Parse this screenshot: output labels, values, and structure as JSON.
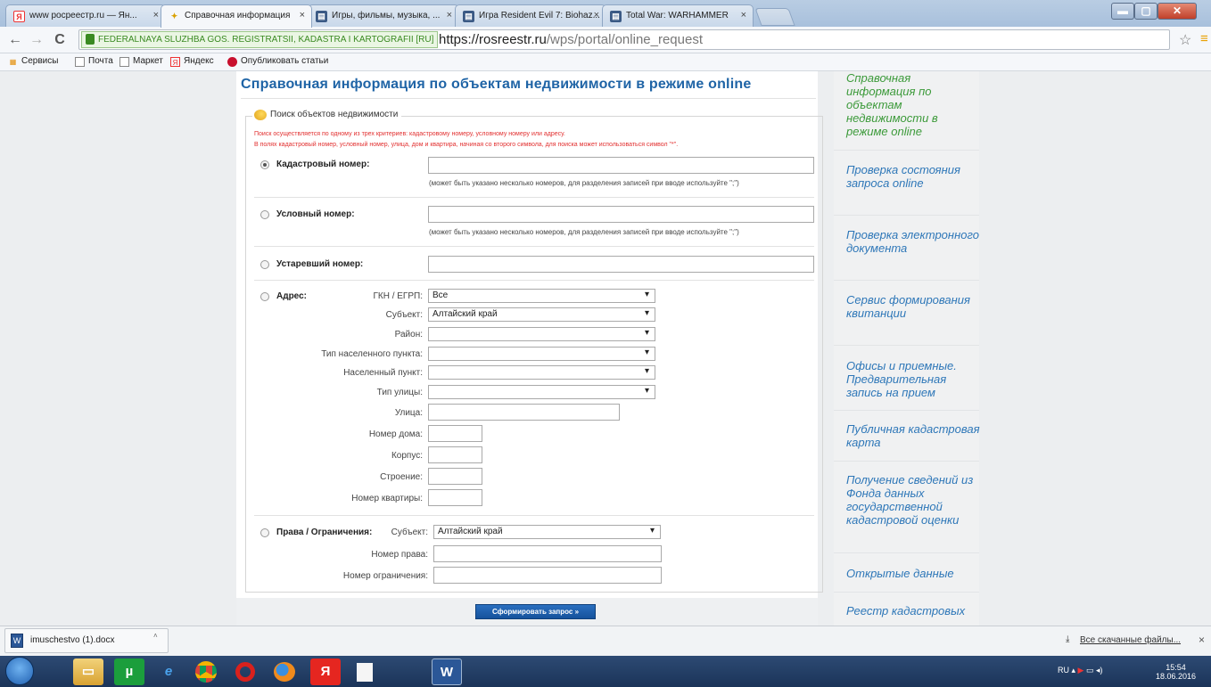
{
  "browser": {
    "tabs": [
      {
        "label": "www росреестр.ru — Ян...",
        "favicon": "Я"
      },
      {
        "label": "Справочная информация",
        "favicon": "✦"
      },
      {
        "label": "Игры, фильмы, музыка, ...",
        "favicon": "▤"
      },
      {
        "label": "Игра Resident Evil 7: Biohaz...",
        "favicon": "▤"
      },
      {
        "label": "Total War: WARHAMMER",
        "favicon": "▤"
      }
    ],
    "close_glyph": "×",
    "secure_label": "FEDERALNAYA SLUZHBA GOS. REGISTRATSII, KADASTRA I KARTOGRAFII [RU]",
    "url_host": "https://rosreestr.ru",
    "url_path": "/wps/portal/online_request",
    "bookmarks": [
      {
        "label": "Сервисы",
        "icon": "apps-icon"
      },
      {
        "label": "Почта",
        "icon": "page-icon"
      },
      {
        "label": "Маркет",
        "icon": "page-icon"
      },
      {
        "label": "Яндекс",
        "icon": "yandex-icon"
      },
      {
        "label": "Опубликовать статьи",
        "icon": "red-dot-icon"
      }
    ]
  },
  "page": {
    "title": "Справочная информация по объектам недвижимости в режиме online",
    "search_legend": "Поиск объектов недвижимости",
    "note1": "Поиск осуществляется по одному из трех критериев: кадастровому номеру, условному номеру или адресу.",
    "note2": "В полях кадастровый номер, условный номер, улица, дом и квартира, начиная со второго символа, для поиска может использоваться символ \"*\".",
    "cadastral_label": "Кадастровый номер:",
    "cadastral_hint": "(может быть указано несколько номеров, для разделения записей при вводе используйте \";\")",
    "conditional_label": "Условный номер:",
    "conditional_hint": "(может быть указано несколько номеров, для разделения записей при вводе используйте \";\")",
    "obsolete_label": "Устаревший номер:",
    "address_label": "Адрес:",
    "address_fields": {
      "gkn_label": "ГКН / ЕГРП:",
      "gkn_value": "Все",
      "subject_label": "Субъект:",
      "subject_value": "Алтайский край",
      "district_label": "Район:",
      "settlement_type_label": "Тип населенного пункта:",
      "settlement_label": "Населенный пункт:",
      "street_type_label": "Тип улицы:",
      "street_label": "Улица:",
      "house_label": "Номер дома:",
      "building_label": "Корпус:",
      "structure_label": "Строение:",
      "apartment_label": "Номер квартиры:"
    },
    "rights_label": "Права / Ограничения:",
    "rights_subject_label": "Субъект:",
    "rights_subject_value": "Алтайский край",
    "right_number_label": "Номер права:",
    "restriction_number_label": "Номер ограничения:",
    "submit_label": "Сформировать запрос »"
  },
  "sidebar": {
    "items": [
      "Справочная информация по объектам недвижимости в режиме online",
      "Проверка состояния запроса online",
      "Проверка электронного документа",
      "Сервис формирования квитанции",
      "Офисы и приемные. Предварительная запись на прием",
      "Публичная кадастровая карта",
      "Получение сведений из Фонда данных государственной кадастровой оценки",
      "Открытые данные",
      "Реестр кадастровых"
    ]
  },
  "downloads": {
    "file": "imuschestvo (1).docx",
    "show_all": "Все скачанные файлы...",
    "close_glyph": "×"
  },
  "taskbar": {
    "lang": "RU",
    "time": "15:54",
    "date": "18.06.2016"
  }
}
